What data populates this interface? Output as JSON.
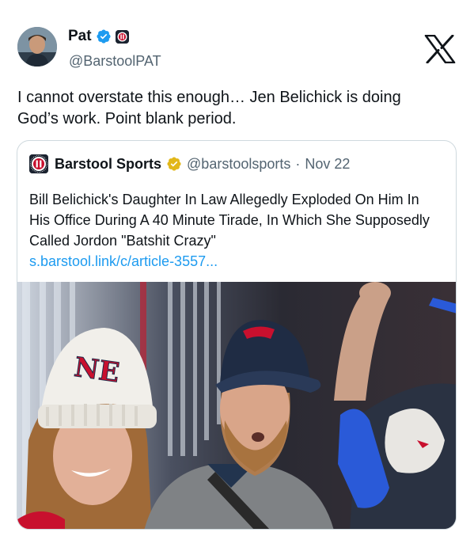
{
  "author": {
    "display_name": "Pat",
    "handle": "@BarstoolPAT",
    "verified": true,
    "affiliate_badge": "barstool-badge"
  },
  "tweet": {
    "text": "I cannot overstate this enough… Jen Belichick is doing God’s work. Point blank period."
  },
  "quoted_tweet": {
    "display_name": "Barstool Sports",
    "handle": "@barstoolsports",
    "separator": "·",
    "date": "Nov 22",
    "verified_org": true,
    "text": "Bill Belichick's Daughter In Law Allegedly Exploded On Him In His Office During A 40 Minute Tirade, In Which She Supposedly Called Jordon \"Batshit Crazy\"",
    "link": "s.barstool.link/c/article-3557...",
    "image": {
      "hat_text": "NE"
    }
  },
  "colors": {
    "verified_blue": "#1d9bf0",
    "verified_gold": "#e2b719",
    "link_blue": "#1d9bf0",
    "secondary_text": "#536471",
    "border": "#cfd9de"
  },
  "icons": [
    "verified-icon",
    "x-logo-icon",
    "barstool-logo-icon",
    "gold-verified-icon"
  ]
}
